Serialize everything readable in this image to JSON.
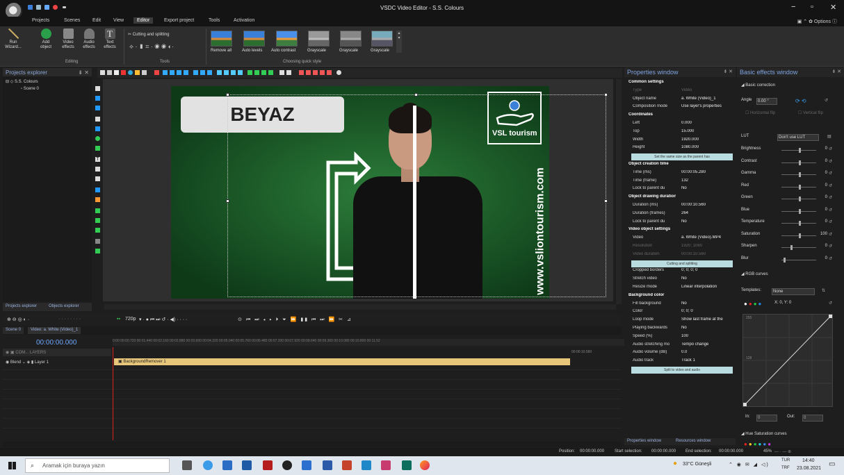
{
  "window": {
    "title": "VSDC Video Editor - S.S. Colours",
    "minimize": "−",
    "restore": "▫",
    "close": "✕"
  },
  "menu": {
    "items": [
      "Projects",
      "Scenes",
      "Edit",
      "View",
      "Editor",
      "Export project",
      "Tools",
      "Activation"
    ],
    "active": "Editor",
    "options": "Options"
  },
  "ribbon": {
    "buttons": [
      {
        "label": "Run Wizard...",
        "icon": "wand-icon"
      },
      {
        "label": "Add object",
        "icon": "add-object-icon"
      },
      {
        "label": "Video effects",
        "icon": "video-effects-icon"
      },
      {
        "label": "Audio effects",
        "icon": "audio-effects-icon"
      },
      {
        "label": "Text effects",
        "icon": "text-effects-icon"
      }
    ],
    "editing_label": "Editing",
    "tools_label": "Tools",
    "cutting": "Cutting and splitting",
    "quick_style_label": "Choosing quick style",
    "styles": [
      "Remove all",
      "Auto levels",
      "Auto contrast",
      "Grayscale",
      "Grayscale",
      "Grayscale"
    ]
  },
  "projects": {
    "title": "Projects explorer",
    "root": "S.S. Colours",
    "scene": "Scene 0",
    "tabs": [
      "Projects explorer",
      "Objects explorer"
    ]
  },
  "video": {
    "label": "BEYAZ",
    "brand": "VSL tourism",
    "url": "www.vsliontourism.com"
  },
  "playback": {
    "quality": "720p"
  },
  "timeline": {
    "tabs": [
      "Scene 0",
      "Video: a. White (Video)_1"
    ],
    "timecode": "00:00:00.000",
    "layers_header": "COM... LAYERS",
    "blend": "Blend",
    "layer": "Layer 1",
    "clip": "BackgroundRemover 1",
    "ruler": "0:00   00:00.720   00:01.440   00:02.160   00:02.880   00:03.600   00:04.320   00:05.040   00:05.760   00:06.480   00:07.200   00:07.920   00:08.640   00:09.360   00:10.080   00:10.800   00:11.52",
    "end_marker": "00:00:10.560"
  },
  "properties": {
    "title": "Properties window",
    "rows": [
      {
        "k": "Common settings",
        "v": "",
        "sec": true
      },
      {
        "k": "Type",
        "v": "Video",
        "dim": true
      },
      {
        "k": "Object name",
        "v": "a. White (Video)_1"
      },
      {
        "k": "Composition mode",
        "v": "Use layer's properties"
      },
      {
        "k": "Coordinates",
        "v": "",
        "sec": true
      },
      {
        "k": "Left",
        "v": "0.000"
      },
      {
        "k": "Top",
        "v": "15.000"
      },
      {
        "k": "Width",
        "v": "1920.000"
      },
      {
        "k": "Height",
        "v": "1080.000"
      },
      {
        "k": "BTN",
        "v": "Set the same size as the parent has"
      },
      {
        "k": "Object creation time",
        "v": "",
        "sec": true
      },
      {
        "k": "Time (ms)",
        "v": "00:00:05.280"
      },
      {
        "k": "Time (frame)",
        "v": "132"
      },
      {
        "k": "Lock to parent du",
        "v": "No"
      },
      {
        "k": "Object drawing duration",
        "v": "",
        "sec": true
      },
      {
        "k": "Duration (ms)",
        "v": "00:00:10.560"
      },
      {
        "k": "Duration (frames)",
        "v": "264"
      },
      {
        "k": "Lock to parent du",
        "v": "No"
      },
      {
        "k": "Video object settings",
        "v": "",
        "sec": true
      },
      {
        "k": "Video",
        "v": "a. White (Video).MP4"
      },
      {
        "k": "Resolution",
        "v": "1920; 1080",
        "dim": true
      },
      {
        "k": "Video duration",
        "v": "00:00:10.560",
        "dim": true
      },
      {
        "k": "BTN",
        "v": "Cutting and splitting"
      },
      {
        "k": "Cropped borders",
        "v": "0; 0; 0; 0"
      },
      {
        "k": "Stretch video",
        "v": "No"
      },
      {
        "k": "Resize mode",
        "v": "Linear interpolation"
      },
      {
        "k": "Background color",
        "v": "",
        "sec": true
      },
      {
        "k": "Fill background",
        "v": "No"
      },
      {
        "k": "Color",
        "v": "0; 0; 0"
      },
      {
        "k": "Loop mode",
        "v": "Show last frame at the"
      },
      {
        "k": "Playing backwards",
        "v": "No"
      },
      {
        "k": "Speed (%)",
        "v": "100"
      },
      {
        "k": "Audio stretching mo",
        "v": "Tempo change"
      },
      {
        "k": "Audio volume (dB)",
        "v": "0.0"
      },
      {
        "k": "Audio track",
        "v": "Track 1"
      },
      {
        "k": "BTN",
        "v": "Split to video and audio"
      }
    ],
    "tabs": [
      "Properties window",
      "Resources window"
    ]
  },
  "basic_effects": {
    "title": "Basic effects window",
    "basic_correction": "Basic correction",
    "angle_label": "Angle",
    "angle_value": "0.00 °",
    "hflip": "Horizontal flip",
    "vflip": "Vertical flip",
    "lut_label": "LUT",
    "lut_value": "Don't use LUT",
    "sliders": [
      {
        "k": "Brightness",
        "v": "0",
        "pos": 0.5
      },
      {
        "k": "Contrast",
        "v": "0",
        "pos": 0.5
      },
      {
        "k": "Gamma",
        "v": "0",
        "pos": 0.5
      },
      {
        "k": "Red",
        "v": "0",
        "pos": 0.5
      },
      {
        "k": "Green",
        "v": "0",
        "pos": 0.5
      },
      {
        "k": "Blue",
        "v": "0",
        "pos": 0.5
      },
      {
        "k": "Temperature",
        "v": "0",
        "pos": 0.5
      },
      {
        "k": "Saturation",
        "v": "100",
        "pos": 0.5
      },
      {
        "k": "Sharpen",
        "v": "0",
        "pos": 0.25
      },
      {
        "k": "Blur",
        "v": "0",
        "pos": 0.05
      }
    ],
    "rgb_curves": "RGB curves",
    "templates_label": "Templates:",
    "templates_value": "None",
    "xy": "X: 0, Y: 0",
    "curve_top": "255",
    "curve_mid": "128",
    "in_label": "In:",
    "out_label": "Out:",
    "in_value": "0",
    "out_value": "0",
    "hue_sat": "Hue Saturation curves"
  },
  "status": {
    "position_label": "Position:",
    "position": "00:00:00.000",
    "start_label": "Start selection:",
    "start": "00:00:00.000",
    "end_label": "End selection:",
    "end": "00:00:00.000",
    "zoom": "45%"
  },
  "taskbar": {
    "search_placeholder": "Aramak için buraya yazın",
    "weather": "33°C Güneşli",
    "lang": "TUR",
    "lang2": "TRF",
    "time": "14:40",
    "date": "23.08.2021"
  }
}
